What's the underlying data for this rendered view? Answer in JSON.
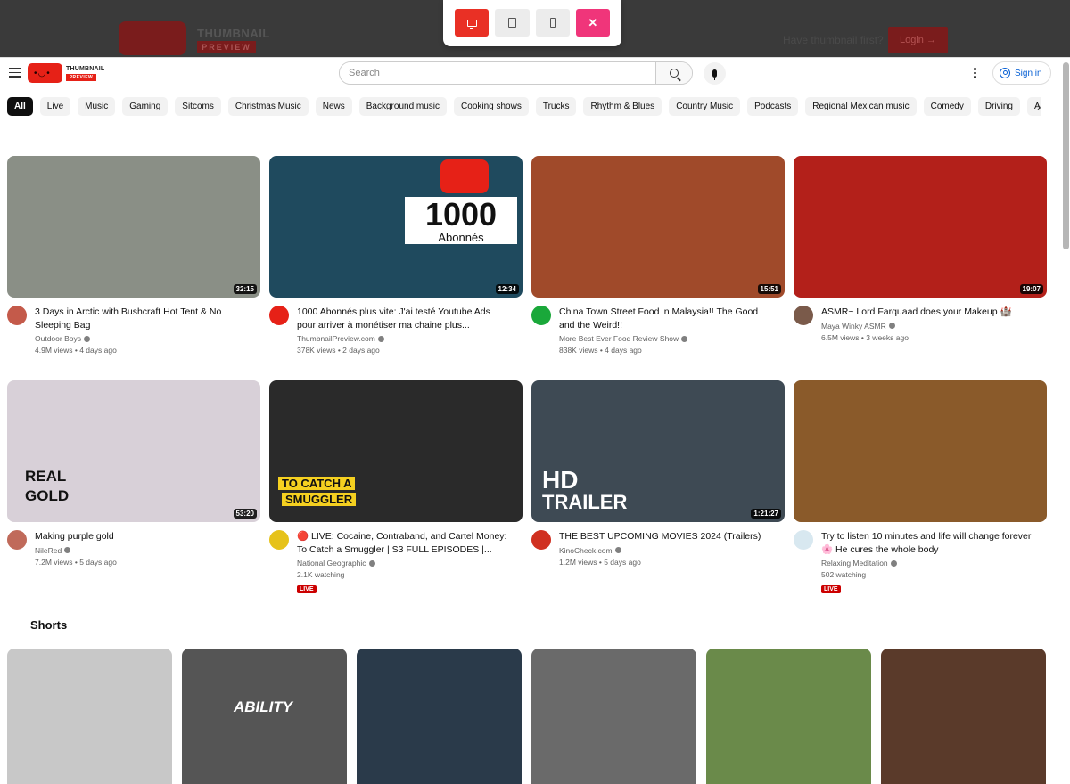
{
  "site": {
    "logo_title": "THUMBNAIL",
    "logo_sub": "PREVIEW",
    "hint": "Have thumbnail first?",
    "login_label": "Login →"
  },
  "device_toolbar": {
    "close_label": "✕"
  },
  "header": {
    "logo_title": "THUMBNAIL",
    "logo_sub": "PREVIEW",
    "search_placeholder": "Search",
    "signin_label": "Sign in"
  },
  "chips": [
    "All",
    "Live",
    "Music",
    "Gaming",
    "Sitcoms",
    "Christmas Music",
    "News",
    "Background music",
    "Cooking shows",
    "Trucks",
    "Rhythm & Blues",
    "Country Music",
    "Podcasts",
    "Regional Mexican music",
    "Comedy",
    "Driving",
    "Action-a"
  ],
  "videos": [
    {
      "title": "3 Days in Arctic with Bushcraft Hot Tent & No Sleeping Bag",
      "channel": "Outdoor Boys",
      "stats": "4.9M views • 4 days ago",
      "duration": "32:15",
      "thumb_color": "#8a8f86",
      "avatar_color": "#c45a4a"
    },
    {
      "title": "1000 Abonnés plus vite: J'ai testé Youtube Ads pour arriver à monétiser ma chaine plus...",
      "channel": "ThumbnailPreview.com",
      "stats": "378K views • 2 days ago",
      "duration": "12:34",
      "thumb_color": "#1f4a5e",
      "avatar_color": "#e62117",
      "thumb_big": "1000",
      "thumb_small": "Abonnés"
    },
    {
      "title": "China Town Street Food in Malaysia!! The Good and the Weird!!",
      "channel": "More Best Ever Food Review Show",
      "stats": "838K views • 4 days ago",
      "duration": "15:51",
      "thumb_color": "#a04a2a",
      "avatar_color": "#1aa83a"
    },
    {
      "title": "ASMR~ Lord Farquaad does your Makeup 🏰",
      "channel": "Maya Winky ASMR",
      "stats": "6.5M views • 3 weeks ago",
      "duration": "19:07",
      "thumb_color": "#b3201a",
      "avatar_color": "#7a5a4a"
    },
    {
      "title": "Making purple gold",
      "channel": "NileRed",
      "stats": "7.2M views • 5 days ago",
      "duration": "53:20",
      "thumb_color": "#d8d0d8",
      "avatar_color": "#c06a5a",
      "thumb_big": "REAL",
      "thumb_small": "GOLD"
    },
    {
      "title": "🔴 LIVE: Cocaine, Contraband, and Cartel Money: To Catch a Smuggler | S3 FULL EPISODES |...",
      "channel": "National Geographic",
      "stats": "2.1K watching",
      "live": "LIVE",
      "thumb_color": "#2a2a2a",
      "avatar_color": "#e6c21a",
      "thumb_big": "TO CATCH A",
      "thumb_small": "SMUGGLER"
    },
    {
      "title": "THE BEST UPCOMING MOVIES 2024 (Trailers)",
      "channel": "KinoCheck.com",
      "stats": "1.2M views • 5 days ago",
      "duration": "1:21:27",
      "thumb_color": "#3e4a54",
      "avatar_color": "#d03020",
      "thumb_big": "HD",
      "thumb_small": "TRAILER"
    },
    {
      "title": "Try to listen 10 minutes and life will change forever 🌸 He cures the whole body",
      "channel": "Relaxing Meditation",
      "stats": "502 watching",
      "live": "LIVE",
      "thumb_color": "#8a5a2a",
      "avatar_color": "#d8e8f0"
    }
  ],
  "shorts": {
    "title": "Shorts",
    "items": [
      {
        "color": "#c8c8c8"
      },
      {
        "color": "#555555",
        "label": "ABILITY"
      },
      {
        "color": "#2a3a4a"
      },
      {
        "color": "#6a6a6a"
      },
      {
        "color": "#6a8a4a"
      },
      {
        "color": "#5a3a2a"
      }
    ]
  }
}
